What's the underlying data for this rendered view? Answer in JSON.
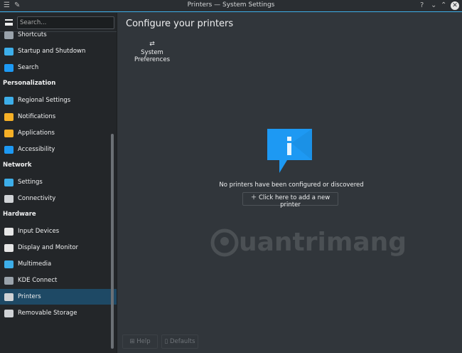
{
  "window": {
    "title": "Printers — System Settings",
    "help": "?",
    "minimize": "⌄",
    "maximize": "⌃",
    "close": "✕"
  },
  "sidebar": {
    "search_placeholder": "Search...",
    "items_top": [
      {
        "label": "Shortcuts",
        "icon": "keyboard-icon",
        "color": "#9aa3ab"
      },
      {
        "label": "Startup and Shutdown",
        "icon": "monitor-icon",
        "color": "#3daee9"
      },
      {
        "label": "Search",
        "icon": "search-icon",
        "color": "#1d99f3"
      }
    ],
    "sections": [
      {
        "header": "Personalization",
        "items": [
          {
            "label": "Regional Settings",
            "icon": "flag-icon",
            "color": "#3daee9"
          },
          {
            "label": "Notifications",
            "icon": "bell-icon",
            "color": "#f6b026"
          },
          {
            "label": "Applications",
            "icon": "star-icon",
            "color": "#f6b026"
          },
          {
            "label": "Accessibility",
            "icon": "accessibility-icon",
            "color": "#1d99f3"
          }
        ]
      },
      {
        "header": "Network",
        "items": [
          {
            "label": "Settings",
            "icon": "globe-icon",
            "color": "#3daee9"
          },
          {
            "label": "Connectivity",
            "icon": "share-icon",
            "color": "#d0d3d6"
          }
        ]
      },
      {
        "header": "Hardware",
        "items": [
          {
            "label": "Input Devices",
            "icon": "keyboard-icon",
            "color": "#e6e6e6"
          },
          {
            "label": "Display and Monitor",
            "icon": "monitor-icon",
            "color": "#e6e6e6"
          },
          {
            "label": "Multimedia",
            "icon": "multimedia-icon",
            "color": "#3daee9"
          },
          {
            "label": "KDE Connect",
            "icon": "phone-icon",
            "color": "#9aa3ab"
          },
          {
            "label": "Printers",
            "icon": "printer-icon",
            "color": "#d0d3d6",
            "selected": true
          },
          {
            "label": "Removable Storage",
            "icon": "drive-icon",
            "color": "#d0d3d6"
          }
        ]
      }
    ]
  },
  "main": {
    "title": "Configure your printers",
    "system_preferences": "System Preferences",
    "empty_message": "No printers have been configured or discovered",
    "add_printer": "Click here to add a new printer",
    "accent": "#1d99f3"
  },
  "footer": {
    "help": "Help",
    "defaults": "Defaults"
  },
  "watermark": "Quantrimang"
}
